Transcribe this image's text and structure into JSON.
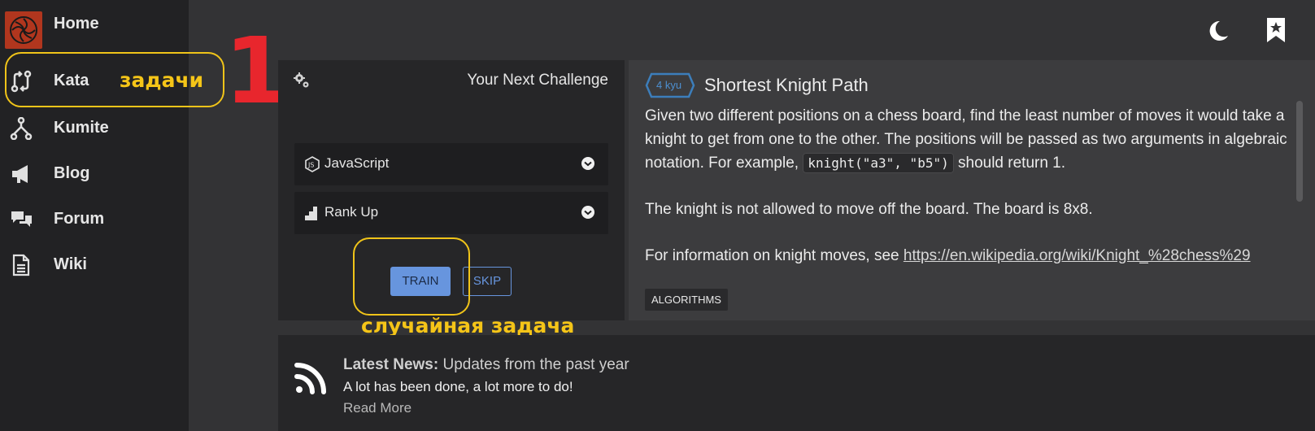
{
  "sidebar": {
    "items": [
      {
        "label": "Home",
        "icon": "codewars-logo-icon"
      },
      {
        "label": "Kata",
        "icon": "kata-arrows-icon"
      },
      {
        "label": "Kumite",
        "icon": "fork-icon"
      },
      {
        "label": "Blog",
        "icon": "megaphone-icon"
      },
      {
        "label": "Forum",
        "icon": "chat-bubbles-icon"
      },
      {
        "label": "Wiki",
        "icon": "document-icon"
      }
    ]
  },
  "annotations": {
    "kata_note": "задачи",
    "step_number": "1.",
    "random_task_note": "случайная задача",
    "color_yellow": "#f5c518",
    "color_red": "#e8262d"
  },
  "challenge": {
    "title": "Your Next Challenge",
    "language": "JavaScript",
    "strategy": "Rank Up",
    "train_label": "TRAIN",
    "skip_label": "SKIP"
  },
  "kata": {
    "rank": "4 kyu",
    "title": "Shortest Knight Path",
    "desc_part1": "Given two different positions on a chess board, find the least number of moves it would take a knight to get from one to the other. The positions will be passed as two arguments in algebraic notation. For example, ",
    "desc_code": "knight(\"a3\", \"b5\")",
    "desc_part2": " should return 1.",
    "desc_p2": "The knight is not allowed to move off the board. The board is 8x8.",
    "desc_p3_prefix": "For information on knight moves, see ",
    "desc_p3_link": "https://en.wikipedia.org/wiki/Knight_%28chess%29",
    "tag": "ALGORITHMS"
  },
  "news": {
    "heading_bold": "Latest News:",
    "heading_rest": " Updates from the past year",
    "subtitle": "A lot has been done, a lot more to do!",
    "read_more": "Read More"
  },
  "colors": {
    "accent_blue": "#6795de",
    "brand_red": "#b1361e"
  }
}
